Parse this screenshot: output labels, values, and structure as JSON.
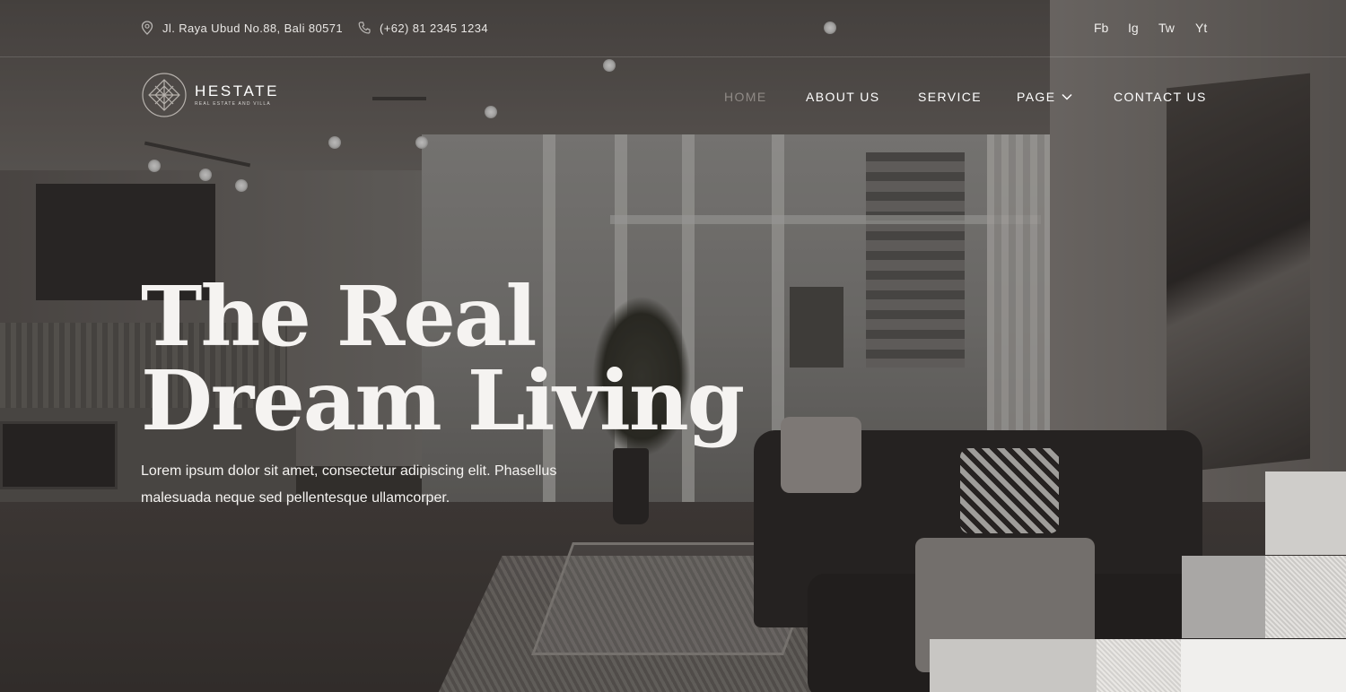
{
  "topbar": {
    "address": "Jl. Raya Ubud No.88, Bali 80571",
    "phone": "(+62) 81 2345 1234",
    "social": [
      {
        "label": "Fb",
        "icon": "facebook"
      },
      {
        "label": "Ig",
        "icon": "instagram"
      },
      {
        "label": "Tw",
        "icon": "twitter"
      },
      {
        "label": "Yt",
        "icon": "youtube"
      }
    ]
  },
  "brand": {
    "name": "HESTATE",
    "tagline": "REAL ESTATE AND VILLA"
  },
  "nav": {
    "items": [
      {
        "label": "HOME",
        "active": true
      },
      {
        "label": "ABOUT US",
        "active": false
      },
      {
        "label": "SERVICE",
        "active": false
      },
      {
        "label": "PAGE",
        "active": false,
        "has_dropdown": true
      },
      {
        "label": "CONTACT US",
        "active": false
      }
    ]
  },
  "hero": {
    "title_line1": "The Real",
    "title_line2": "Dream Living",
    "subtitle_line1": "Lorem ipsum dolor sit amet, consectetur adipiscing elit. Phasellus",
    "subtitle_line2": "malesuada neque sed pellentesque ullamcorper."
  },
  "colors": {
    "text": "#ffffff",
    "nav_active": "#8f8a86",
    "overlay": "#2a2624"
  }
}
